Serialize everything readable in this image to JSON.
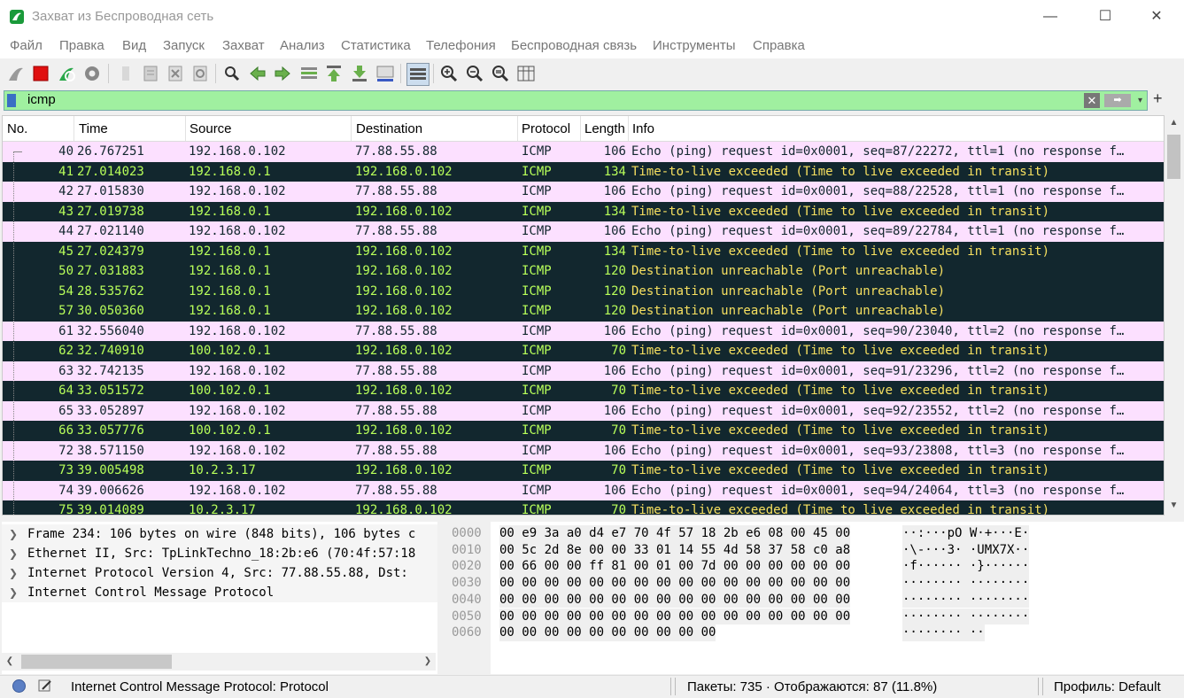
{
  "window": {
    "title": "Захват из Беспроводная сеть",
    "minimize": "—",
    "maximize": "☐",
    "close": "✕"
  },
  "menu": [
    "Файл",
    "Правка",
    "Вид",
    "Запуск",
    "Захват",
    "Анализ",
    "Статистика",
    "Телефония",
    "Беспроводная связь",
    "Инструменты",
    "Справка"
  ],
  "toolbar": {
    "icons": [
      "shark-fin-start-icon",
      "stop-icon",
      "restart-icon",
      "options-gear-icon",
      "open-file-icon",
      "save-file-icon",
      "close-file-icon",
      "reload-icon",
      "find-icon",
      "back-arrow-icon",
      "forward-arrow-icon",
      "goto-packet-icon",
      "first-packet-icon",
      "last-packet-icon",
      "autoscroll-icon",
      "colorize-icon",
      "zoom-in-icon",
      "zoom-out-icon",
      "zoom-reset-icon",
      "resize-columns-icon"
    ]
  },
  "filter": {
    "value": "icmp",
    "background": "#a0f0a0",
    "clear": "✕",
    "apply": "➡",
    "dropdown": "▾",
    "add": "+"
  },
  "packet_list": {
    "columns": [
      "No.",
      "Time",
      "Source",
      "Destination",
      "Protocol",
      "Length",
      "Info"
    ],
    "colors": {
      "request_bg": "#fce0ff",
      "reply_bg": "#12272e",
      "reply_fg": "#b8ff5a"
    },
    "rows": [
      {
        "no": "40",
        "time": "26.767251",
        "src": "192.168.0.102",
        "dst": "77.88.55.88",
        "proto": "ICMP",
        "len": "106",
        "info": "Echo (ping) request  id=0x0001, seq=87/22272, ttl=1 (no response f…",
        "style": "light"
      },
      {
        "no": "41",
        "time": "27.014023",
        "src": "192.168.0.1",
        "dst": "192.168.0.102",
        "proto": "ICMP",
        "len": "134",
        "info": "Time-to-live exceeded (Time to live exceeded in transit)",
        "style": "dark"
      },
      {
        "no": "42",
        "time": "27.015830",
        "src": "192.168.0.102",
        "dst": "77.88.55.88",
        "proto": "ICMP",
        "len": "106",
        "info": "Echo (ping) request  id=0x0001, seq=88/22528, ttl=1 (no response f…",
        "style": "light"
      },
      {
        "no": "43",
        "time": "27.019738",
        "src": "192.168.0.1",
        "dst": "192.168.0.102",
        "proto": "ICMP",
        "len": "134",
        "info": "Time-to-live exceeded (Time to live exceeded in transit)",
        "style": "dark"
      },
      {
        "no": "44",
        "time": "27.021140",
        "src": "192.168.0.102",
        "dst": "77.88.55.88",
        "proto": "ICMP",
        "len": "106",
        "info": "Echo (ping) request  id=0x0001, seq=89/22784, ttl=1 (no response f…",
        "style": "light"
      },
      {
        "no": "45",
        "time": "27.024379",
        "src": "192.168.0.1",
        "dst": "192.168.0.102",
        "proto": "ICMP",
        "len": "134",
        "info": "Time-to-live exceeded (Time to live exceeded in transit)",
        "style": "dark"
      },
      {
        "no": "50",
        "time": "27.031883",
        "src": "192.168.0.1",
        "dst": "192.168.0.102",
        "proto": "ICMP",
        "len": "120",
        "info": "Destination unreachable (Port unreachable)",
        "style": "dark"
      },
      {
        "no": "54",
        "time": "28.535762",
        "src": "192.168.0.1",
        "dst": "192.168.0.102",
        "proto": "ICMP",
        "len": "120",
        "info": "Destination unreachable (Port unreachable)",
        "style": "dark"
      },
      {
        "no": "57",
        "time": "30.050360",
        "src": "192.168.0.1",
        "dst": "192.168.0.102",
        "proto": "ICMP",
        "len": "120",
        "info": "Destination unreachable (Port unreachable)",
        "style": "dark"
      },
      {
        "no": "61",
        "time": "32.556040",
        "src": "192.168.0.102",
        "dst": "77.88.55.88",
        "proto": "ICMP",
        "len": "106",
        "info": "Echo (ping) request  id=0x0001, seq=90/23040, ttl=2 (no response f…",
        "style": "light"
      },
      {
        "no": "62",
        "time": "32.740910",
        "src": "100.102.0.1",
        "dst": "192.168.0.102",
        "proto": "ICMP",
        "len": "70",
        "info": "Time-to-live exceeded (Time to live exceeded in transit)",
        "style": "dark"
      },
      {
        "no": "63",
        "time": "32.742135",
        "src": "192.168.0.102",
        "dst": "77.88.55.88",
        "proto": "ICMP",
        "len": "106",
        "info": "Echo (ping) request  id=0x0001, seq=91/23296, ttl=2 (no response f…",
        "style": "light"
      },
      {
        "no": "64",
        "time": "33.051572",
        "src": "100.102.0.1",
        "dst": "192.168.0.102",
        "proto": "ICMP",
        "len": "70",
        "info": "Time-to-live exceeded (Time to live exceeded in transit)",
        "style": "dark"
      },
      {
        "no": "65",
        "time": "33.052897",
        "src": "192.168.0.102",
        "dst": "77.88.55.88",
        "proto": "ICMP",
        "len": "106",
        "info": "Echo (ping) request  id=0x0001, seq=92/23552, ttl=2 (no response f…",
        "style": "light"
      },
      {
        "no": "66",
        "time": "33.057776",
        "src": "100.102.0.1",
        "dst": "192.168.0.102",
        "proto": "ICMP",
        "len": "70",
        "info": "Time-to-live exceeded (Time to live exceeded in transit)",
        "style": "dark"
      },
      {
        "no": "72",
        "time": "38.571150",
        "src": "192.168.0.102",
        "dst": "77.88.55.88",
        "proto": "ICMP",
        "len": "106",
        "info": "Echo (ping) request  id=0x0001, seq=93/23808, ttl=3 (no response f…",
        "style": "light"
      },
      {
        "no": "73",
        "time": "39.005498",
        "src": "10.2.3.17",
        "dst": "192.168.0.102",
        "proto": "ICMP",
        "len": "70",
        "info": "Time-to-live exceeded (Time to live exceeded in transit)",
        "style": "dark"
      },
      {
        "no": "74",
        "time": "39.006626",
        "src": "192.168.0.102",
        "dst": "77.88.55.88",
        "proto": "ICMP",
        "len": "106",
        "info": "Echo (ping) request  id=0x0001, seq=94/24064, ttl=3 (no response f…",
        "style": "light"
      },
      {
        "no": "75",
        "time": "39.014089",
        "src": "10.2.3.17",
        "dst": "192.168.0.102",
        "proto": "ICMP",
        "len": "70",
        "info": "Time-to-live exceeded (Time to live exceeded in transit)",
        "style": "dark"
      }
    ]
  },
  "details": [
    {
      "arrow": "❯",
      "text": "Frame 234: 106 bytes on wire (848 bits), 106 bytes c"
    },
    {
      "arrow": "❯",
      "text": "Ethernet II, Src: TpLinkTechno_18:2b:e6 (70:4f:57:18"
    },
    {
      "arrow": "❯",
      "text": "Internet Protocol Version 4, Src: 77.88.55.88, Dst:"
    },
    {
      "arrow": "❯",
      "text": "Internet Control Message Protocol"
    }
  ],
  "bytes": [
    {
      "off": "0000",
      "hex": "00 e9 3a a0 d4 e7 70 4f  57 18 2b e6 08 00 45 00",
      "asc": "··:···pO W·+···E·"
    },
    {
      "off": "0010",
      "hex": "00 5c 2d 8e 00 00 33 01  14 55 4d 58 37 58 c0 a8",
      "asc": "·\\-···3· ·UMX7X··"
    },
    {
      "off": "0020",
      "hex": "00 66 00 00 ff 81 00 01  00 7d 00 00 00 00 00 00",
      "asc": "·f······ ·}······"
    },
    {
      "off": "0030",
      "hex": "00 00 00 00 00 00 00 00  00 00 00 00 00 00 00 00",
      "asc": "········ ········"
    },
    {
      "off": "0040",
      "hex": "00 00 00 00 00 00 00 00  00 00 00 00 00 00 00 00",
      "asc": "········ ········"
    },
    {
      "off": "0050",
      "hex": "00 00 00 00 00 00 00 00  00 00 00 00 00 00 00 00",
      "asc": "········ ········"
    },
    {
      "off": "0060",
      "hex": "00 00 00 00 00 00 00 00  00 00",
      "asc": "········ ··"
    }
  ],
  "status": {
    "field": "Internet Control Message Protocol: Protocol",
    "packets": "Пакеты: 735 · Отображаются: 87 (11.8%)",
    "profile": "Профиль: Default"
  }
}
